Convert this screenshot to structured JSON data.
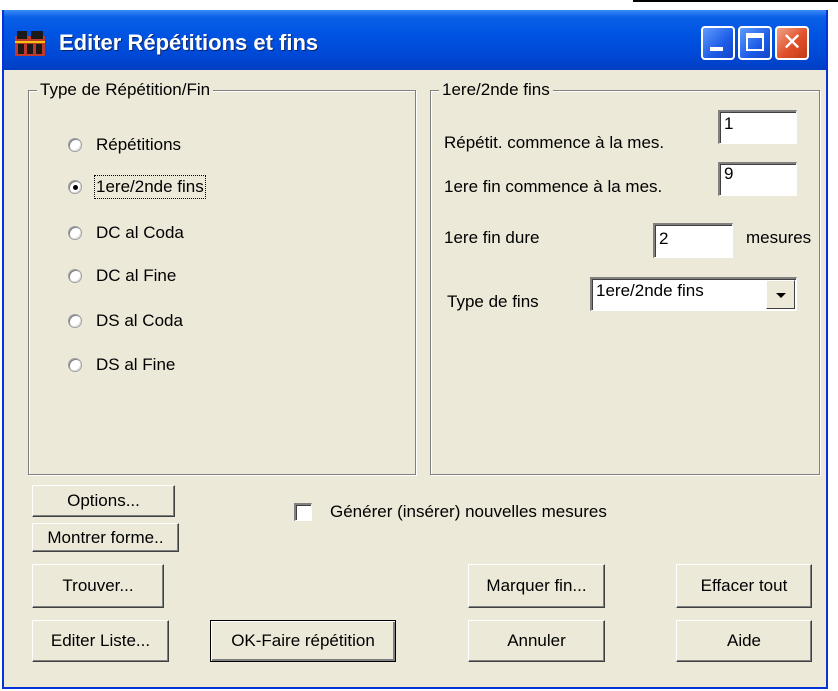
{
  "window": {
    "title": "Editer Répétitions et fins",
    "controls": {
      "minimize": "minimize-icon",
      "maximize": "maximize-icon",
      "close": "close-icon"
    }
  },
  "left_group": {
    "legend": "Type de Répétition/Fin",
    "options": [
      {
        "label": "Répétitions",
        "checked": false
      },
      {
        "label": "1ere/2nde fins",
        "checked": true
      },
      {
        "label": "DC al Coda",
        "checked": false
      },
      {
        "label": "DC al Fine",
        "checked": false
      },
      {
        "label": "DS al Coda",
        "checked": false
      },
      {
        "label": "DS al Fine",
        "checked": false
      }
    ]
  },
  "right_group": {
    "legend": "1ere/2nde fins",
    "repeat_start_label": "Répétit. commence à la mes.",
    "repeat_start_value": "1",
    "first_end_start_label": "1ere fin commence à la mes.",
    "first_end_start_value": "9",
    "first_end_duration_label": "1ere fin dure",
    "first_end_duration_value": "2",
    "first_end_duration_unit": "mesures",
    "endings_type_label": "Type de fins",
    "endings_type_value": "1ere/2nde fins"
  },
  "checkbox": {
    "label": "Générer (insérer) nouvelles mesures",
    "checked": false
  },
  "buttons": {
    "options": "Options...",
    "show_form": "Montrer forme..",
    "find": "Trouver...",
    "edit_list": "Editer Liste...",
    "ok": "OK-Faire répétition",
    "mark_end": "Marquer fin...",
    "clear_all": "Effacer tout",
    "cancel": "Annuler",
    "help": "Aide"
  },
  "colors": {
    "titlebar": "#0054e3",
    "dialog_face": "#ece9d8",
    "close_button": "#e0502a"
  }
}
